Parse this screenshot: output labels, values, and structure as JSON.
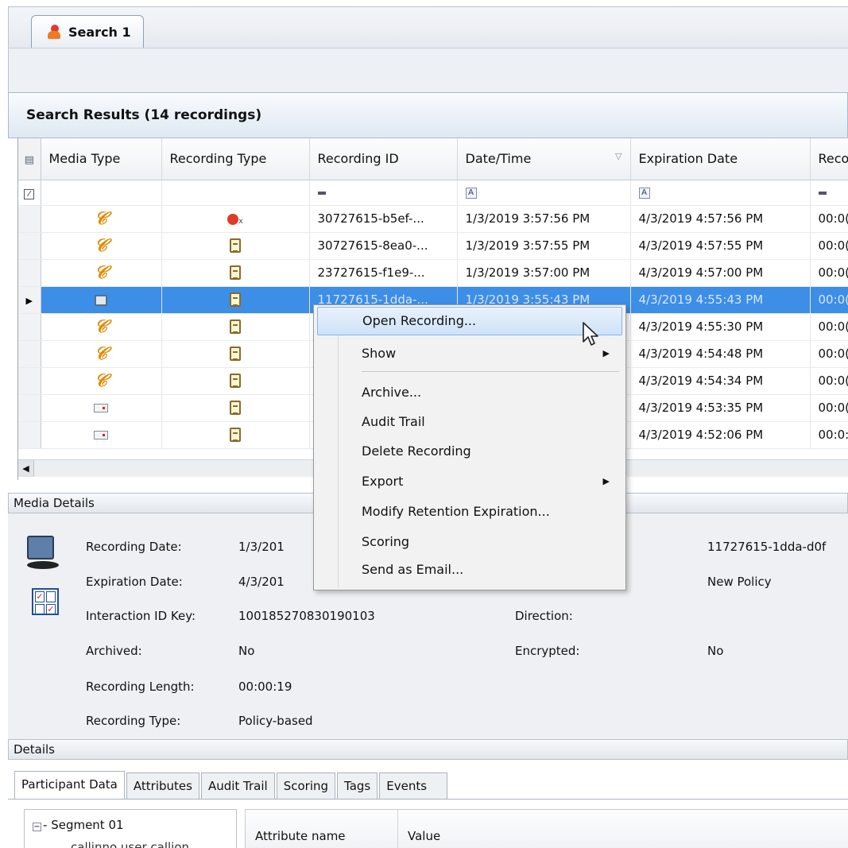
{
  "window": {
    "tab_label": "Search 1"
  },
  "results": {
    "header": "Search Results (14 recordings)"
  },
  "grid": {
    "columns": [
      "Media Type",
      "Recording Type",
      "Recording ID",
      "Date/Time",
      "Expiration Date",
      "Reco"
    ],
    "rows": [
      {
        "media": "phone",
        "rectype": "dot",
        "id": "30727615-b5ef-...",
        "datetime": "1/3/2019 3:57:56 PM",
        "expiration": "4/3/2019 4:57:56 PM",
        "reco": "00:0("
      },
      {
        "media": "phone",
        "rectype": "clip",
        "id": "30727615-8ea0-...",
        "datetime": "1/3/2019 3:57:55 PM",
        "expiration": "4/3/2019 4:57:55 PM",
        "reco": "00:0("
      },
      {
        "media": "phone",
        "rectype": "clip",
        "id": "23727615-f1e9-...",
        "datetime": "1/3/2019 3:57:00 PM",
        "expiration": "4/3/2019 4:57:00 PM",
        "reco": "00:0("
      },
      {
        "media": "screen",
        "rectype": "clip",
        "id": "11727615-1dda-...",
        "datetime": "1/3/2019 3:55:43 PM",
        "expiration": "4/3/2019 4:55:43 PM",
        "reco": "00:0("
      },
      {
        "media": "phone",
        "rectype": "clip",
        "id": "",
        "datetime": "",
        "expiration": "4/3/2019 4:55:30 PM",
        "reco": "00:0("
      },
      {
        "media": "phone",
        "rectype": "clip",
        "id": "",
        "datetime": "",
        "expiration": "4/3/2019 4:54:48 PM",
        "reco": "00:0("
      },
      {
        "media": "phone",
        "rectype": "clip",
        "id": "",
        "datetime": "",
        "expiration": "4/3/2019 4:54:34 PM",
        "reco": "00:0("
      },
      {
        "media": "email",
        "rectype": "clip",
        "id": "",
        "datetime": "",
        "expiration": "4/3/2019 4:53:35 PM",
        "reco": "00:0("
      },
      {
        "media": "email",
        "rectype": "clip",
        "id": "",
        "datetime": "",
        "expiration": "4/3/2019 4:52:06 PM",
        "reco": "00:0:"
      }
    ]
  },
  "media_details": {
    "title": "Media Details",
    "recording_date_label": "Recording Date:",
    "recording_date_value": "1/3/201",
    "expiration_date_label": "Expiration Date:",
    "expiration_date_value": "4/3/201",
    "interaction_id_label": "Interaction ID Key:",
    "interaction_id_value": "100185270830190103",
    "archived_label": "Archived:",
    "archived_value": "No",
    "recording_length_label": "Recording Length:",
    "recording_length_value": "00:00:19",
    "recording_type_label": "Recording Type:",
    "recording_type_value": "Policy-based",
    "recording_id_value": "11727615-1dda-d0f",
    "policy_value": "New Policy",
    "direction_label": "Direction:",
    "encrypted_label": "Encrypted:",
    "encrypted_value": "No"
  },
  "details": {
    "title": "Details",
    "tabs": [
      "Participant Data",
      "Attributes",
      "Audit Trail",
      "Scoring",
      "Tags",
      "Events"
    ],
    "tree_root": "Segment 01",
    "tree_child": "callinno user callion",
    "col_attr": "Attribute name",
    "col_value": "Value"
  },
  "context_menu": {
    "items": [
      "Open Recording...",
      "Show",
      "Archive...",
      "Audit Trail",
      "Delete Recording",
      "Export",
      "Modify Retention Expiration...",
      "Scoring",
      "Send as Email..."
    ]
  },
  "colors": {
    "selected_row": "#3d8ee6",
    "accent_border": "#86b4e8"
  }
}
